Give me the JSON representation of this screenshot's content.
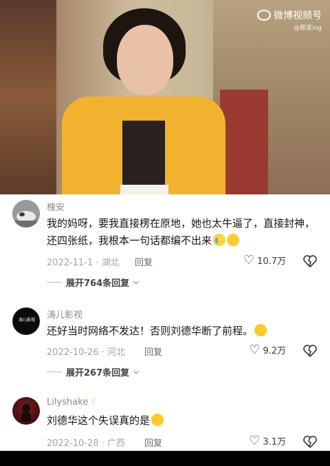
{
  "watermark": {
    "brand": "微博视频号",
    "account": "@郎亚ing"
  },
  "comments": [
    {
      "username": "槐安",
      "text": "我的妈呀，要我直接楞在原地，她也太牛逼了，直接封神，还四张纸，我根本一句话都编不出来",
      "emojis": [
        "crying-face",
        "fearful-face"
      ],
      "date": "2022-11-1",
      "location": "湖北",
      "reply_label": "回复",
      "likes": "10.7万",
      "expand_label": "展开764条回复",
      "avatar_icon": "cat-avatar"
    },
    {
      "username": "涛儿影视",
      "text": "还好当时网络不发达！否则刘德华断了前程。",
      "emojis": [
        "laughing-tears-face"
      ],
      "date": "2022-10-26",
      "location": "河北",
      "reply_label": "回复",
      "likes": "9.2万",
      "expand_label": "展开267条回复",
      "avatar_icon": "studio-logo-avatar",
      "avatar_text": "涛儿影视"
    },
    {
      "username": "Lilyshake",
      "username_icon": "moon-icon",
      "text": "刘德华这个失误真的是",
      "emojis": [
        "laughing-tears-face"
      ],
      "date": "2022-10-28",
      "location": "广西",
      "reply_label": "回复",
      "likes": "3.1万",
      "avatar_icon": "dark-red-avatar"
    }
  ],
  "colors": {
    "text_primary": "#161616",
    "text_secondary": "#8a8a8a",
    "meta": "#a4a4a4",
    "video_accent": "#f1b32f"
  }
}
